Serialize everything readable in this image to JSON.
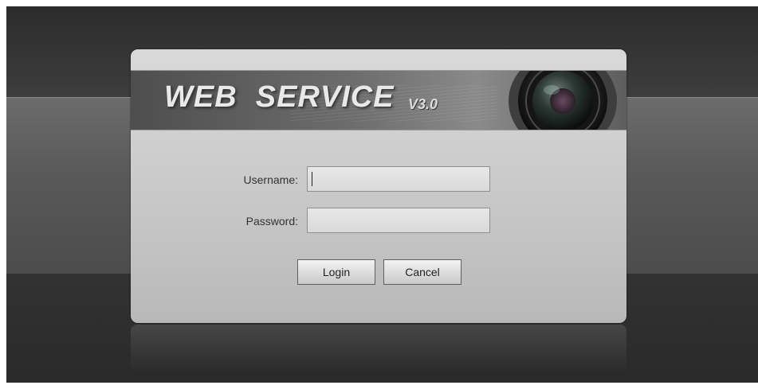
{
  "banner": {
    "title": "WEB  SERVICE",
    "version": "V3.0"
  },
  "login_form": {
    "username_label": "Username:",
    "username_value": "",
    "password_label": "Password:",
    "password_value": "",
    "login_label": "Login",
    "cancel_label": "Cancel"
  },
  "colors": {
    "background": "#2b2b2b",
    "dialog": "#c8c8c8",
    "banner": "#6d6d6d"
  },
  "icons": {
    "banner_graphic": "camera-lens-icon"
  }
}
